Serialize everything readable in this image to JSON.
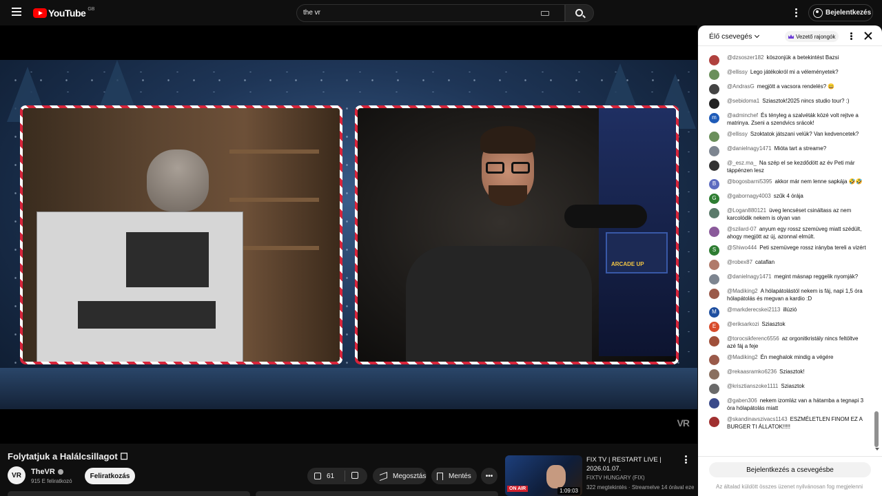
{
  "header": {
    "logo_text": "YouTube",
    "region": "GB",
    "search_value": "the vr",
    "signin_label": "Bejelentkezés"
  },
  "player": {
    "watermark": "VR",
    "arcade_label": "ARCADE UP"
  },
  "video": {
    "title": "Folytatjuk a Halálcsillagot ☐",
    "channel_initials": "VR",
    "channel_name": "TheVR",
    "subscribers": "915 E feliratkozó",
    "subscribe_label": "Feliratkozás",
    "like_count": "61",
    "share_label": "Megosztás",
    "save_label": "Mentés",
    "more_label": "•••"
  },
  "recommendation": {
    "title": "FIX TV | RESTART LIVE | 2026.01.07.",
    "channel": "FIXTV HUNGARY (FIX)",
    "meta": "322 megtekintés · Streamelve 14 órával ezelőtt",
    "duration": "1:09:03",
    "badge": "ON AIR"
  },
  "chat": {
    "title": "Élő csevegés",
    "fans_label": "Vezető rajongók",
    "messages": [
      {
        "author": "@dzsoszer182",
        "text": "köszonjük a betekintést Bazsi",
        "initial": "",
        "color": "#b0413e"
      },
      {
        "author": "@ellissy",
        "text": "Lego játékokról mi a véleményetek?",
        "initial": "",
        "color": "#6a8f5b"
      },
      {
        "author": "@AndrasG",
        "text": "megjött a vacsora rendelés? 😀",
        "initial": "",
        "color": "#444444"
      },
      {
        "author": "@sebidoma1",
        "text": "Sziasztok!2025 nincs studio tour? :)",
        "initial": "",
        "color": "#222222"
      },
      {
        "author": "@adminchef",
        "text": "És tényleg a szalvéták közé volt rejtve a matrinya. Zseni a szendvics srácok!",
        "initial": "m",
        "color": "#1e5bb8"
      },
      {
        "author": "@ellissy",
        "text": "Szoktatok játszani velük? Van kedvencetek?",
        "initial": "",
        "color": "#6a8f5b"
      },
      {
        "author": "@danielnagy1471",
        "text": "Mióta tart a streame?",
        "initial": "",
        "color": "#7d8590"
      },
      {
        "author": "@_esz.ma_",
        "text": "Na szép el se kezdődött az év Peti már táppénzen lesz",
        "initial": "",
        "color": "#333333"
      },
      {
        "author": "@bogosbarni5395",
        "text": "akkor már nem lenne sapkája 🤣🤣",
        "initial": "B",
        "color": "#5c6bc0"
      },
      {
        "author": "@gabornagy4003",
        "text": "szűk 4 órája",
        "initial": "G",
        "color": "#2e7d32"
      },
      {
        "author": "@Logan880121",
        "text": "üveg lencséset csináltass az nem karcolódik nekem is olyan van",
        "initial": "",
        "color": "#5a7a6a"
      },
      {
        "author": "@szilard-07",
        "text": "anyum egy rossz szemüveg miatt szédült, ahogy megjött az új, azonnal elmúlt.",
        "initial": "",
        "color": "#8a5a9a"
      },
      {
        "author": "@Shiwo444",
        "text": "Peti szemüvege rossz irányba tereli a vizért",
        "initial": "S",
        "color": "#2e7d32"
      },
      {
        "author": "@robex87",
        "text": "cataflan",
        "initial": "",
        "color": "#b07a6a"
      },
      {
        "author": "@danielnagy1471",
        "text": "megint másnap reggelik nyomják?",
        "initial": "",
        "color": "#7d8590"
      },
      {
        "author": "@Madiking2",
        "text": "A hólapátolástól nekem is fáj, napi 1,5 óra hólapátolás és megvan a kardio :D",
        "initial": "",
        "color": "#9a5a4a"
      },
      {
        "author": "@markderecskei2113",
        "text": "illúzió",
        "initial": "M",
        "color": "#1e4fa0"
      },
      {
        "author": "@eriksarkozi",
        "text": "Sziasztok",
        "initial": "E",
        "color": "#d84b2a"
      },
      {
        "author": "@torocsikferenc6556",
        "text": "az orgonitkristály nincs feltöltve azé fáj a feje",
        "initial": "",
        "color": "#a0503a"
      },
      {
        "author": "@Madiking2",
        "text": "Én meghalok mindig a végére",
        "initial": "",
        "color": "#9a5a4a"
      },
      {
        "author": "@rekaasramko6236",
        "text": "Sziasztok!",
        "initial": "",
        "color": "#8a7060"
      },
      {
        "author": "@krisztianszoke1111",
        "text": "Sziasztok",
        "initial": "",
        "color": "#6a6a6a"
      },
      {
        "author": "@gaben306",
        "text": "nekem izomláz van a hátamba a tegnapi 3 óra hólapátolás miatt",
        "initial": "",
        "color": "#3a4a8a"
      },
      {
        "author": "@skandinavszivacs1143",
        "text": "ESZMÉLETLEN FINOM EZ A BURGER TI ÁLLATOK!!!!!",
        "initial": "",
        "color": "#a03030"
      }
    ],
    "signin_button": "Bejelentkezés a csevegésbe",
    "footer_note": "Az általad küldött összes üzenet nyilvánosan fog megjelenni"
  }
}
